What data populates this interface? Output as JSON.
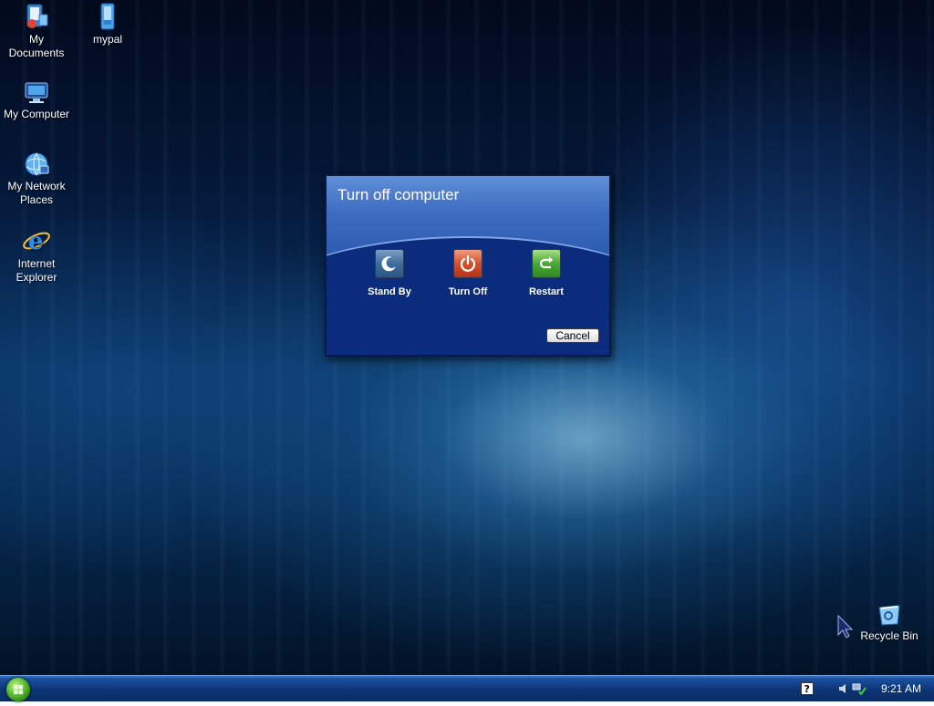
{
  "desktop": {
    "icons": [
      {
        "name": "my-documents",
        "label": "My Documents"
      },
      {
        "name": "mypal",
        "label": "mypal"
      },
      {
        "name": "my-computer",
        "label": "My Computer"
      },
      {
        "name": "my-network-places",
        "label": "My Network Places"
      },
      {
        "name": "internet-explorer",
        "label": "Internet Explorer"
      },
      {
        "name": "recycle-bin",
        "label": "Recycle Bin"
      }
    ]
  },
  "dialog": {
    "title": "Turn off computer",
    "buttons": [
      {
        "label": "Stand By",
        "icon": "moon-icon",
        "color": "#3e6d9c"
      },
      {
        "label": "Turn Off",
        "icon": "power-icon",
        "color": "#d2502e"
      },
      {
        "label": "Restart",
        "icon": "restart-arrow-icon",
        "color": "#4aa837"
      }
    ],
    "cancel_label": "Cancel"
  },
  "taskbar": {
    "start_icon": "windows-orb-icon",
    "tray_icons": [
      "help-icon",
      "volume-icon",
      "network-icon"
    ],
    "clock": "9:21 AM"
  },
  "colors": {
    "desktop_accent": "#08305e",
    "dialog_body": "#0a2a7a",
    "taskbar": "#0b3474"
  }
}
